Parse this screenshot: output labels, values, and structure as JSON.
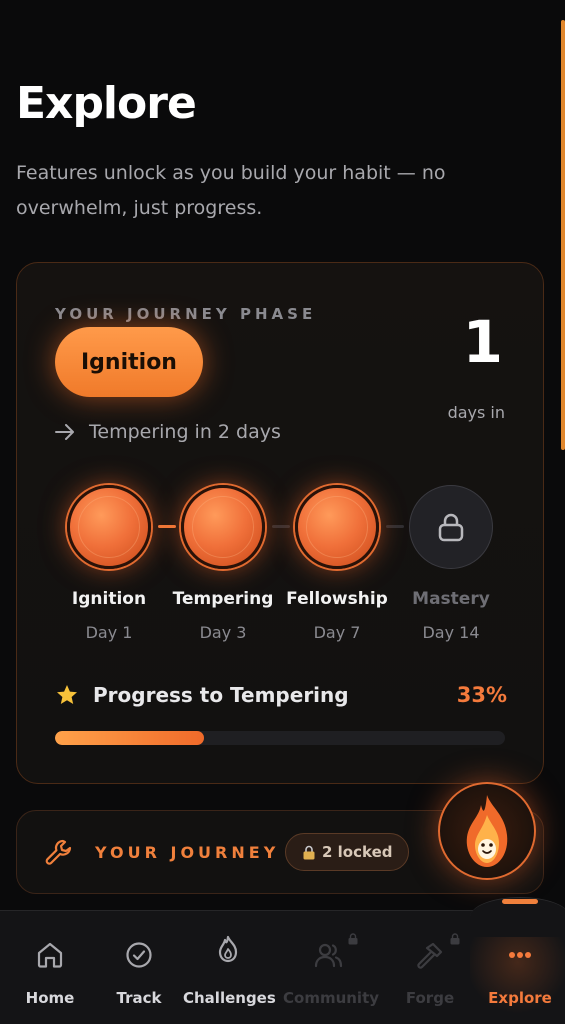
{
  "page": {
    "title": "Explore",
    "subtitle": "Features unlock as you build your habit — no overwhelm, just progress."
  },
  "phase_card": {
    "eyebrow": "YOUR JOURNEY PHASE",
    "current_phase": "Ignition",
    "days_count": "1",
    "days_label": "days in",
    "next_phase_text": "Tempering in 2 days",
    "stages": [
      {
        "name": "Ignition",
        "day": "Day 1",
        "state": "unlocked"
      },
      {
        "name": "Tempering",
        "day": "Day 3",
        "state": "unlocked"
      },
      {
        "name": "Fellowship",
        "day": "Day 7",
        "state": "unlocked"
      },
      {
        "name": "Mastery",
        "day": "Day 14",
        "state": "locked"
      }
    ],
    "progress": {
      "label": "Progress to Tempering",
      "percent_text": "33%",
      "value": 0.33
    }
  },
  "journey_card": {
    "label": "YOUR JOURNEY",
    "locked_badge": "2 locked",
    "icon": "wrench-icon"
  },
  "mascot": {
    "icon": "flame-mascot-icon"
  },
  "bottom_nav": {
    "items": [
      {
        "label": "Home",
        "icon": "home-icon",
        "state": "normal"
      },
      {
        "label": "Track",
        "icon": "check-circle-icon",
        "state": "normal"
      },
      {
        "label": "Challenges",
        "icon": "flame-icon",
        "state": "normal"
      },
      {
        "label": "Community",
        "icon": "people-icon",
        "state": "locked"
      },
      {
        "label": "Forge",
        "icon": "hammer-icon",
        "state": "locked"
      },
      {
        "label": "Explore",
        "icon": "more-dots-icon",
        "state": "active"
      }
    ]
  },
  "colors": {
    "accent": "#f47a3c",
    "background": "#0a0a0b",
    "card_border": "#4a2a16"
  }
}
